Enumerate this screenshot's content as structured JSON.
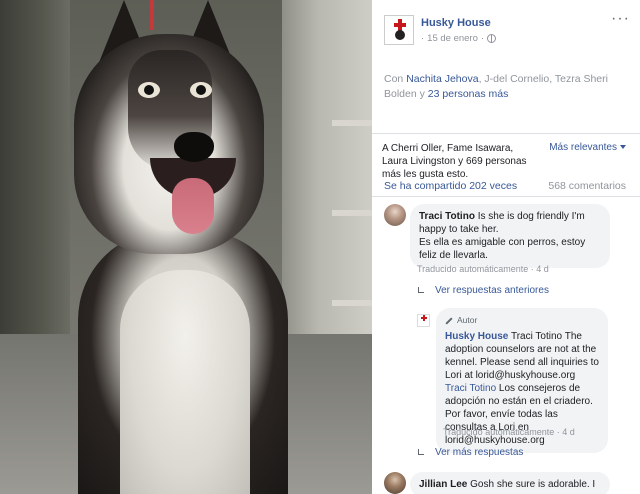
{
  "post": {
    "page_name": "Husky House",
    "date": "15 de enero",
    "separator": "·",
    "tagged_prefix": "Con",
    "tagged_1": "Nachita Jehova",
    "tagged_2": "J-del Cornelio",
    "tagged_3": "Tezra Sheri Bolden",
    "tagged_conj": "y",
    "tagged_more": "23 personas más",
    "likes_text": "A Cherri Oller, Fame Isawara, Laura Livingston y 669 personas más les gusta esto.",
    "sort_label": "Más relevantes",
    "shares": "Se ha compartido 202 veces",
    "comments_count": "568 comentarios",
    "more_icon": "···"
  },
  "comments": {
    "traci": {
      "name": "Traci Totino",
      "text": "Is she is dog friendly I'm happy to take her.",
      "translation": "Es ella es amigable con perros, estoy feliz de llevarla.",
      "meta": "Traducido automáticamente · 4 d"
    },
    "view_previous": "Ver respuestas anteriores",
    "reply": {
      "badge": "Autor",
      "name": "Husky House",
      "mention": "Traci Totino",
      "text": "The adoption counselors are not at the kennel. Please send all inquiries to Lori at lorid@huskyhouse.org",
      "mention_translated": "Traci Totino",
      "translation": "Los consejeros de adopción no están en el criadero. Por favor, envíe todas las consultas a Lori en lorid@huskyhouse.org",
      "meta": "Traducido automáticamente · 4 d"
    },
    "view_more": "Ver más respuestas",
    "jillian": {
      "name": "Jillian Lee",
      "text": "Gosh she sure is adorable. I"
    }
  }
}
